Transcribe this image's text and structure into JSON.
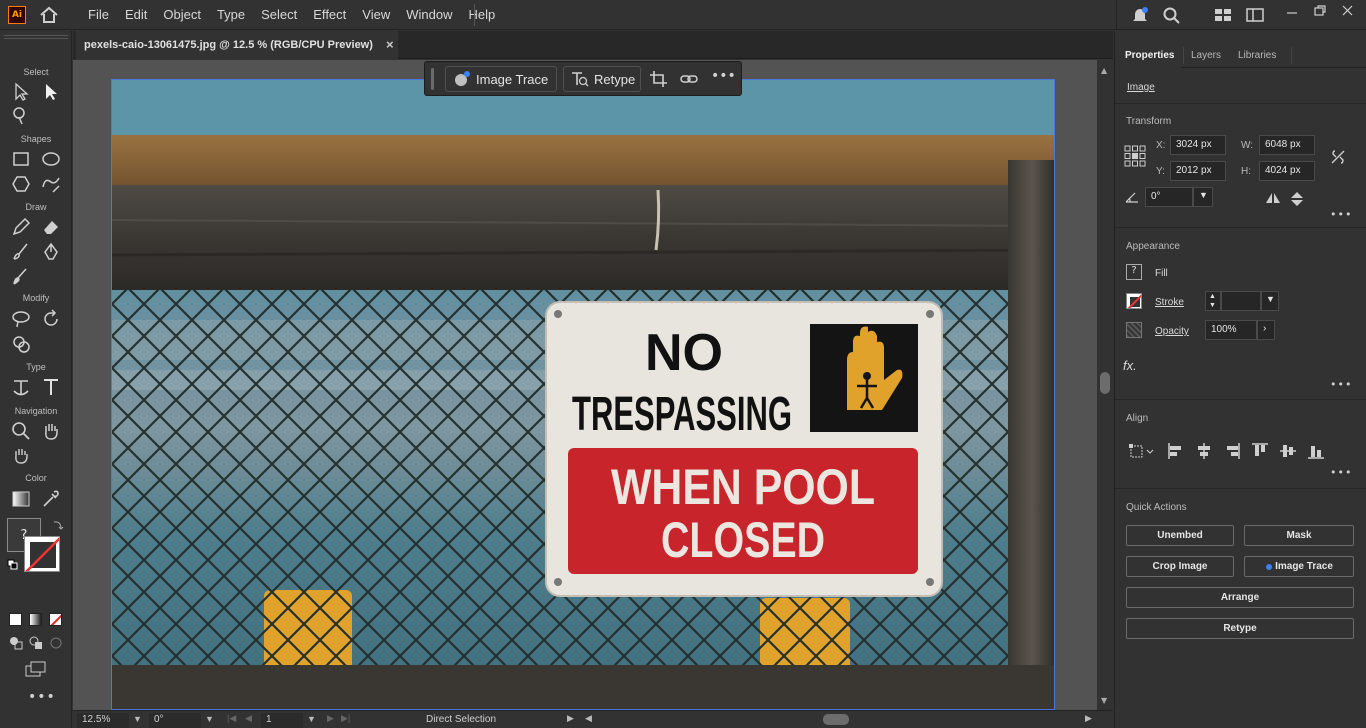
{
  "app": {
    "logo": "Ai",
    "menu": [
      "File",
      "Edit",
      "Object",
      "Type",
      "Select",
      "Effect",
      "View",
      "Window",
      "Help"
    ]
  },
  "toolbar": {
    "groups": [
      "Select",
      "Shapes",
      "Draw",
      "Modify",
      "Type",
      "Navigation",
      "Color"
    ],
    "swatch_question": "?"
  },
  "document": {
    "tab_title": "pexels-caio-13061475.jpg @ 12.5 % (RGB/CPU Preview)",
    "close": "×"
  },
  "taskbar": {
    "image_trace": "Image Trace",
    "retype": "Retype"
  },
  "sign": {
    "line1": "NO",
    "line2": "TRESPASSING",
    "line3": "WHEN POOL",
    "line4": "CLOSED"
  },
  "statusbar": {
    "zoom": "12.5%",
    "rotation": "0°",
    "artboard": "1",
    "tool": "Direct Selection"
  },
  "panel": {
    "tabs": [
      "Properties",
      "Layers",
      "Libraries"
    ],
    "object_type": "Image",
    "transform": {
      "title": "Transform",
      "x_label": "X:",
      "x": "3024 px",
      "y_label": "Y:",
      "y": "2012 px",
      "w_label": "W:",
      "w": "6048 px",
      "h_label": "H:",
      "h": "4024 px",
      "angle": "0°"
    },
    "appearance": {
      "title": "Appearance",
      "fill_label": "Fill",
      "fill_value": "?",
      "stroke_label": "Stroke",
      "opacity_label": "Opacity",
      "opacity": "100%",
      "fx": "fx."
    },
    "align": {
      "title": "Align"
    },
    "quick_actions": {
      "title": "Quick Actions",
      "unembed": "Unembed",
      "mask": "Mask",
      "crop_image": "Crop Image",
      "image_trace": "Image Trace",
      "arrange": "Arrange",
      "retype": "Retype"
    }
  },
  "colors": {
    "accent": "#4a78d6",
    "sign_red": "#c8242c",
    "sign_yellow": "#e0a22a"
  }
}
